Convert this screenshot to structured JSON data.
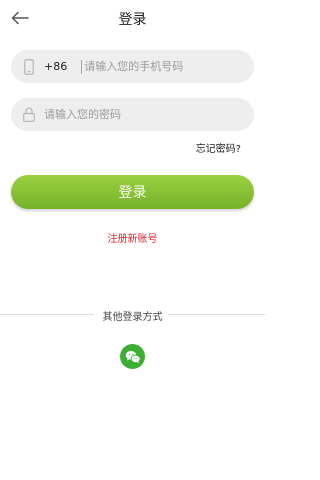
{
  "header": {
    "title": "登录",
    "back_icon": "arrow-left-icon"
  },
  "phone_field": {
    "country_code": "+86",
    "placeholder": "请输入您的手机号码",
    "value": "",
    "icon": "phone-icon"
  },
  "password_field": {
    "placeholder": "请输入您的密码",
    "value": "",
    "icon": "lock-icon"
  },
  "forgot_password_label": "忘记密码?",
  "login_button_label": "登录",
  "register_label": "注册新账号",
  "other_login": {
    "label": "其他登录方式",
    "wechat_icon": "wechat-icon"
  },
  "colors": {
    "accent_green": "#8cc43b",
    "register_red": "#d9262b",
    "wechat_green": "#3cae31",
    "field_bg": "#eeeeee"
  }
}
